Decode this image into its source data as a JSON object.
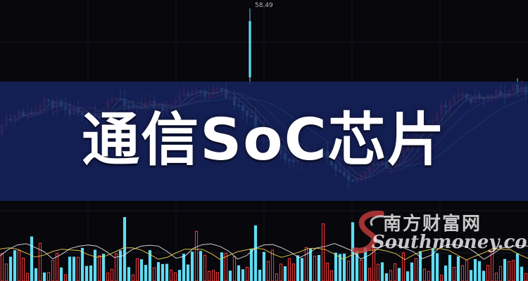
{
  "headline": "通信SoC芯片",
  "peak_price": "58.49",
  "watermark": {
    "cn": "南方财富网",
    "en": "Southmoney.com",
    "logo_icon": "swoosh-s-logo-icon"
  },
  "colors": {
    "background": "#07070c",
    "banner": "#16225c",
    "up_candle": "#ff3b3b",
    "down_candle": "#5fdcf2",
    "ma_white": "#e6e6e6",
    "ma_yellow": "#f2d34a",
    "ma_magenta": "#e04bd8",
    "ma_green": "#3ad16a"
  }
}
